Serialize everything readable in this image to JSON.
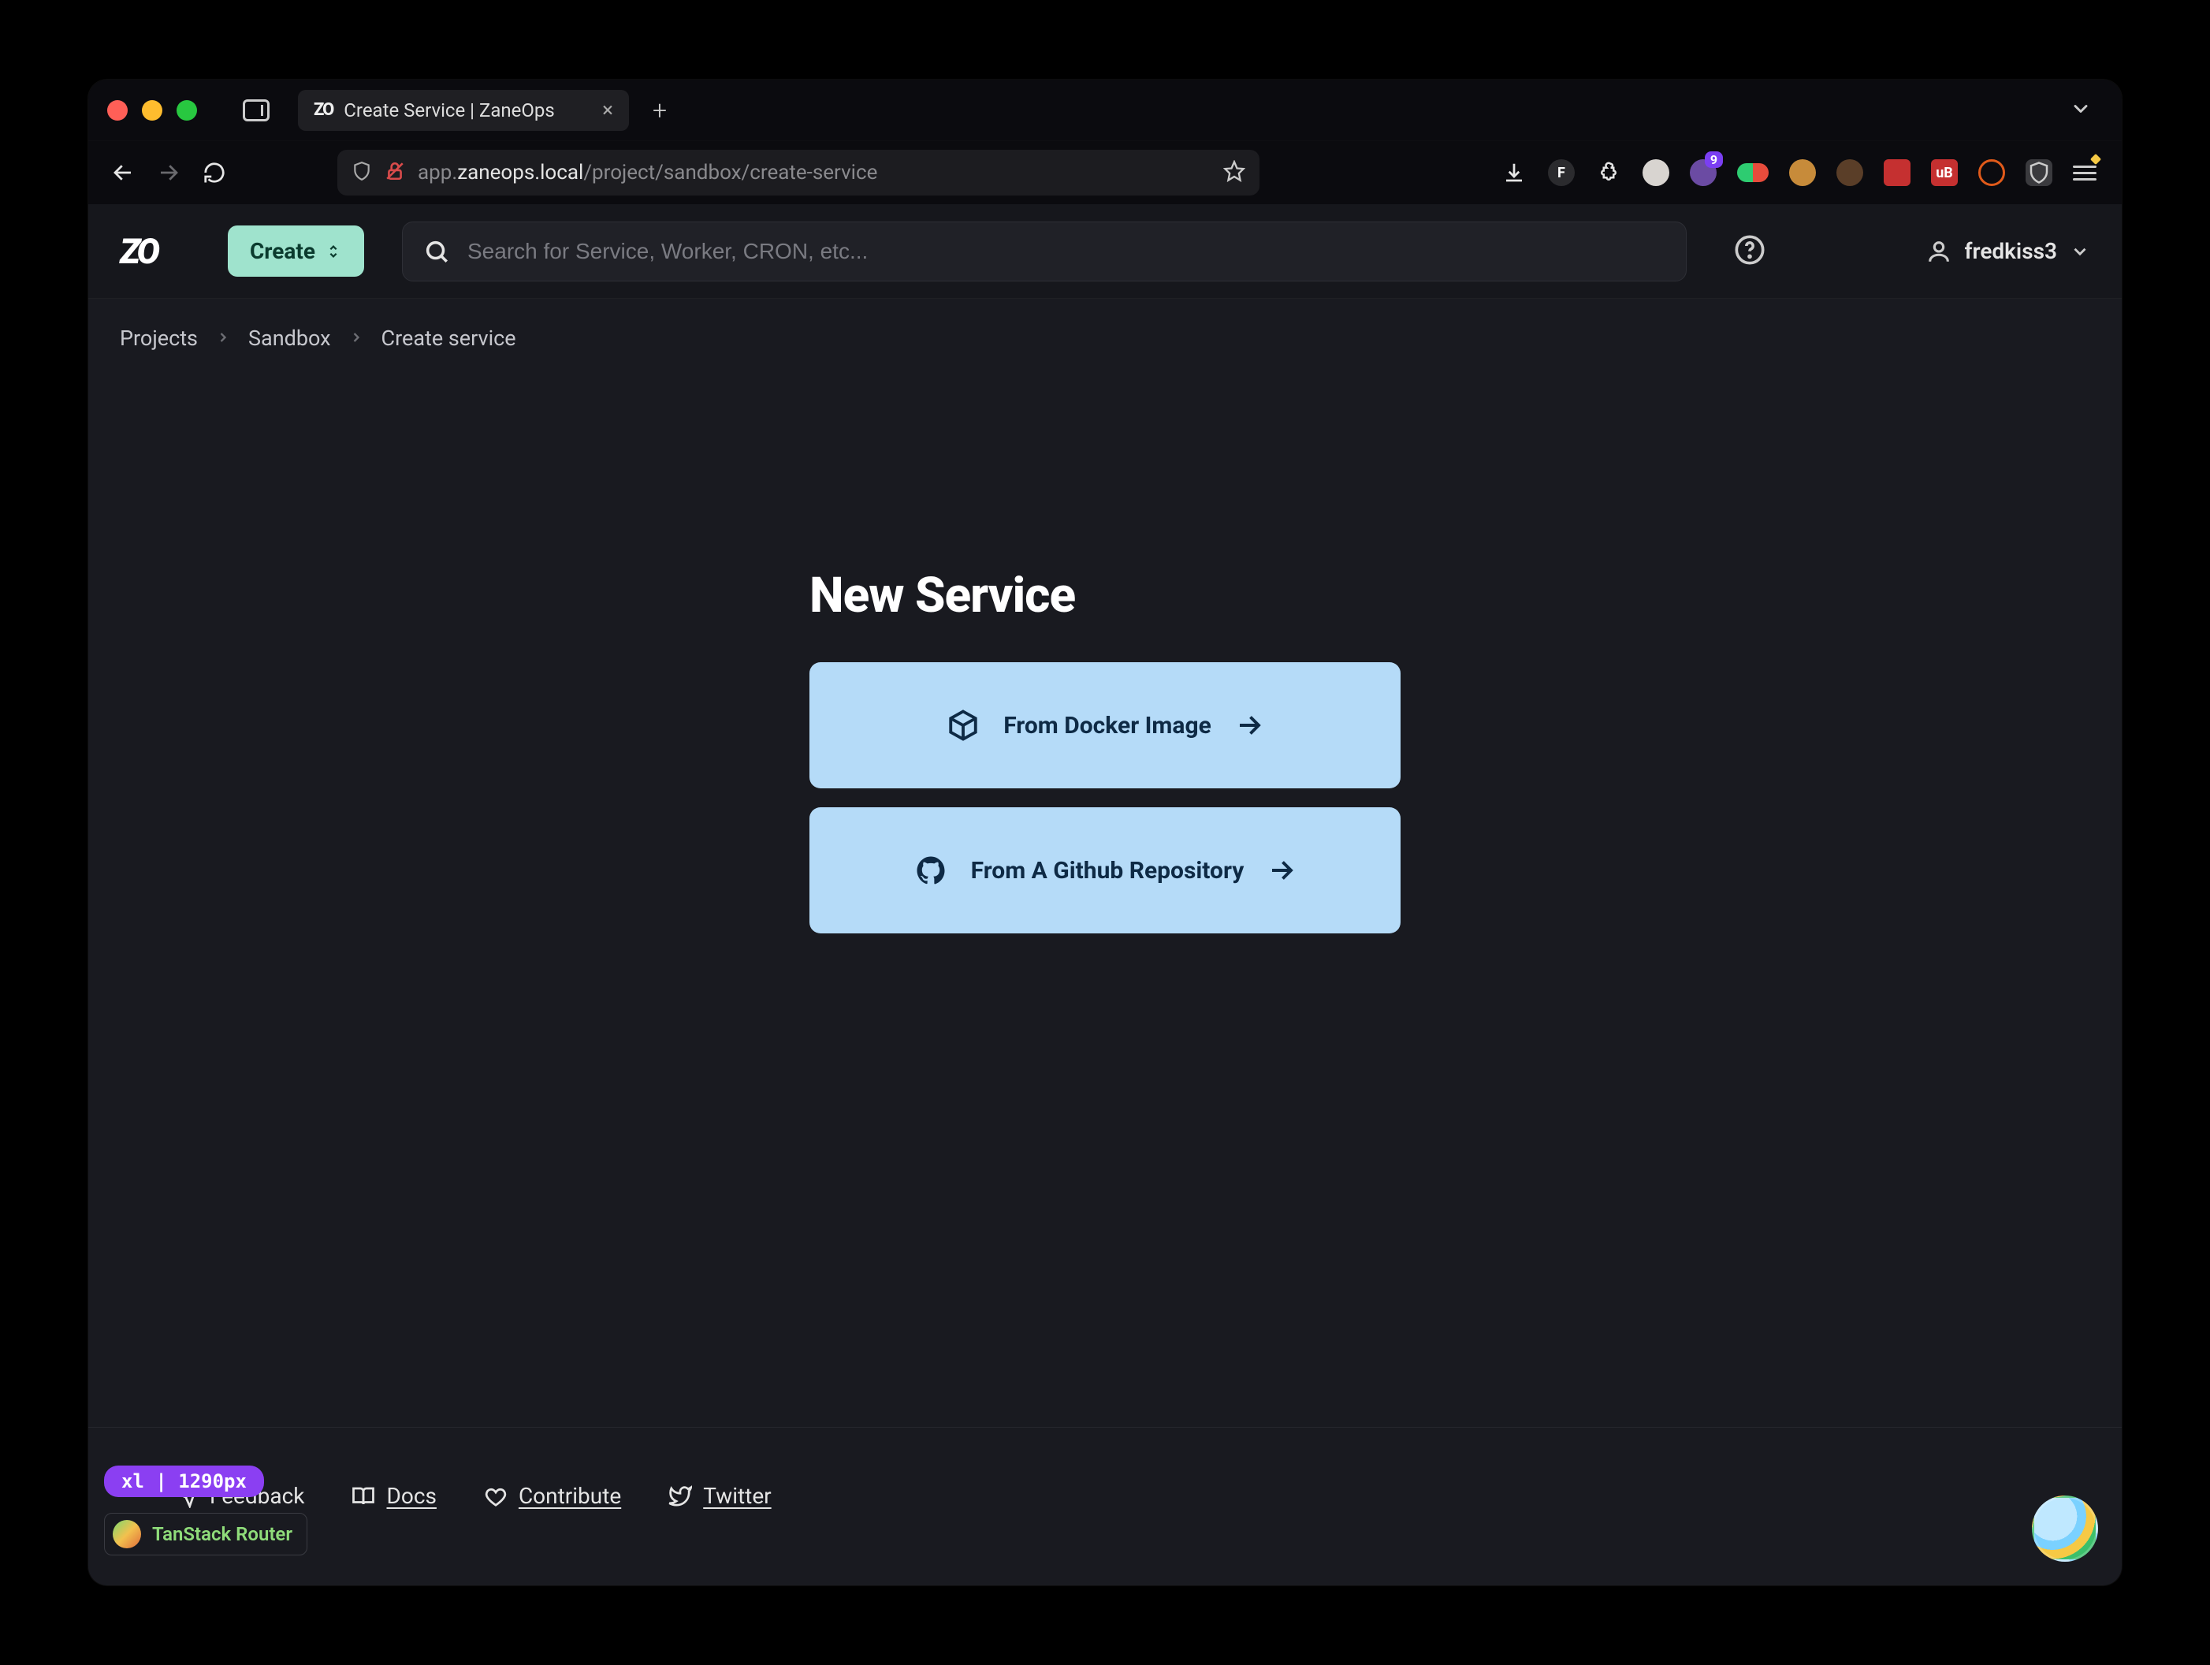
{
  "browser": {
    "tab_title": "Create Service | ZaneOps",
    "url_prefix": "app.",
    "url_host": "zaneops.local",
    "url_path": "/project/sandbox/create-service",
    "ext_badge": "9",
    "ext_f": "F",
    "ext_ub": "uB"
  },
  "header": {
    "logo": "ZO",
    "create_label": "Create",
    "search_placeholder": "Search for Service, Worker, CRON, etc...",
    "username": "fredkiss3"
  },
  "breadcrumb": {
    "items": [
      "Projects",
      "Sandbox",
      "Create service"
    ]
  },
  "page": {
    "title": "New Service",
    "option_docker": "From Docker Image",
    "option_github": "From A Github Repository"
  },
  "footer": {
    "feedback": "Feedback",
    "docs": "Docs",
    "contribute": "Contribute",
    "twitter": "Twitter",
    "breakpoint": "xl | 1290px",
    "tanstack": "TanStack Router"
  }
}
